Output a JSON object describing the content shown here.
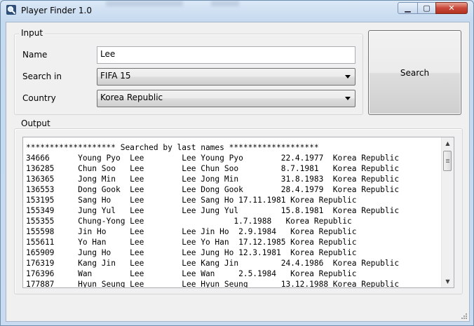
{
  "window": {
    "title": "Player Finder 1.0"
  },
  "titlebar": {
    "minimize": "▁",
    "maximize": "▢",
    "close": "✕"
  },
  "input_group": {
    "legend": "Input",
    "name_label": "Name",
    "name_value": "Lee",
    "search_in_label": "Search in",
    "search_in_value": "FIFA 15",
    "country_label": "Country",
    "country_value": "Korea Republic"
  },
  "search_button": {
    "label": "Search"
  },
  "output_group": {
    "legend": "Output",
    "header": "******************* Searched by last names *******************",
    "rows": [
      "34666      Young Pyo  Lee        Lee Young Pyo        22.4.1977  Korea Republic",
      "136285     Chun Soo   Lee        Lee Chun Soo         8.7.1981   Korea Republic",
      "136365     Jong Min   Lee        Lee Jong Min         31.8.1983  Korea Republic",
      "136553     Dong Gook  Lee        Lee Dong Gook        28.4.1979  Korea Republic",
      "153195     Sang Ho    Lee        Lee Sang Ho 17.11.1981 Korea Republic",
      "155349     Jung Yul   Lee        Lee Jung Yul         15.8.1981  Korea Republic",
      "155355     Chung-Yong Lee                   1.7.1988   Korea Republic",
      "155598     Jin Ho     Lee        Lee Jin Ho  2.9.1984   Korea Republic",
      "155611     Yo Han     Lee        Lee Yo Han  17.12.1985 Korea Republic",
      "165909     Jung Ho    Lee        Lee Jung Ho 12.3.1981  Korea Republic",
      "176319     Kang Jin   Lee        Lee Kang Jin         24.4.1986  Korea Republic",
      "176396     Wan        Lee        Lee Wan     2.5.1984   Korea Republic",
      "177887     Hyun Seung Lee        Lee Hyun Seung       13.12.1988 Korea Republic"
    ]
  }
}
